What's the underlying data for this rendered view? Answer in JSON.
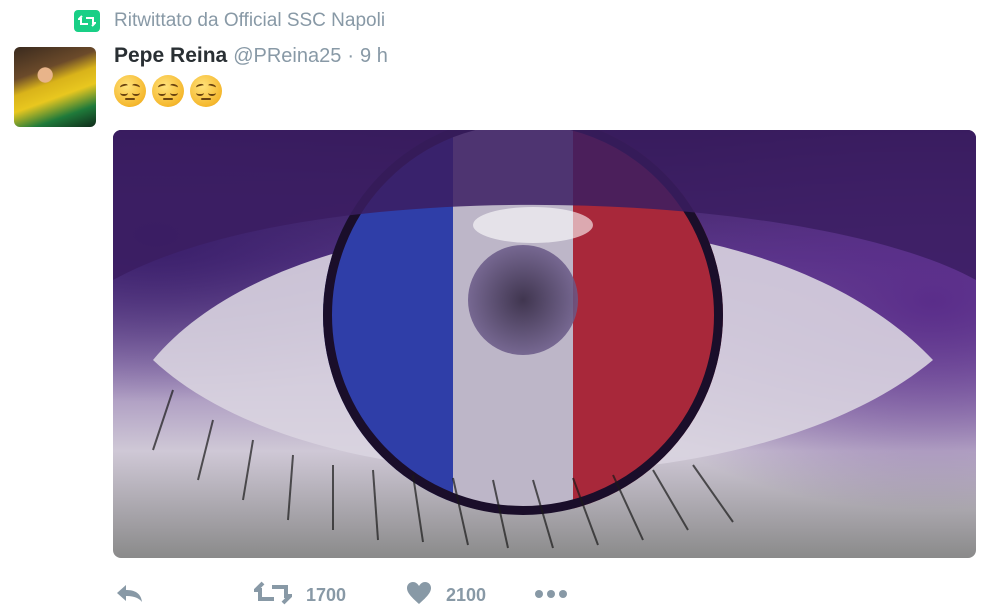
{
  "retweet": {
    "label": "Ritwittato da Official SSC Napoli",
    "icon": "retweet-icon"
  },
  "tweet": {
    "author_name": "Pepe Reina",
    "handle": "@PReina25",
    "separator": "·",
    "time": "9 h",
    "emojis": [
      "pensive-face-emoji",
      "pensive-face-emoji",
      "pensive-face-emoji"
    ]
  },
  "media": {
    "description_icon": "eye-with-french-flag-image"
  },
  "actions": {
    "reply_icon": "reply-icon",
    "retweet_icon": "retweet-icon",
    "retweet_count": "1700",
    "like_icon": "heart-icon",
    "like_count": "2100",
    "more_icon": "more-dots-icon"
  },
  "colors": {
    "accent_green": "#19cf86",
    "muted": "#8899a6",
    "text": "#292f33"
  }
}
